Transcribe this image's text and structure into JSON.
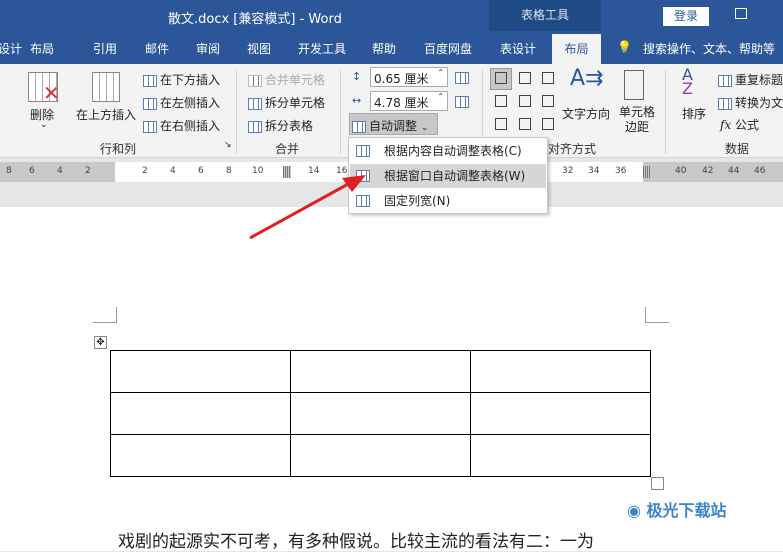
{
  "title_bar": {
    "doc_title": "散文.docx [兼容模式]  -  Word",
    "context_tab": "表格工具",
    "login": "登录"
  },
  "tabs": [
    {
      "label": "设计"
    },
    {
      "label": "布局"
    },
    {
      "label": "引用"
    },
    {
      "label": "邮件"
    },
    {
      "label": "审阅"
    },
    {
      "label": "视图"
    },
    {
      "label": "开发工具"
    },
    {
      "label": "帮助"
    },
    {
      "label": "百度网盘"
    },
    {
      "label": "表设计"
    },
    {
      "label": "布局",
      "active": true
    }
  ],
  "search": "搜索操作、文本、帮助等",
  "ribbon": {
    "rows_cols": {
      "delete": "删除",
      "insert_above": "在上方插入",
      "insert_below": "在下方插入",
      "insert_left": "在左侧插入",
      "insert_right": "在右侧插入",
      "group": "行和列"
    },
    "merge": {
      "merge_cells": "合并单元格",
      "split_cells": "拆分单元格",
      "split_table": "拆分表格",
      "group": "合并"
    },
    "size": {
      "height": "0.65 厘米",
      "width": "4.78 厘米",
      "autofit": "自动调整"
    },
    "align": {
      "text_direction": "文字方向",
      "cell_margins": "单元格边距",
      "group": "对齐方式"
    },
    "data": {
      "sort": "排序",
      "repeat_header": "重复标题",
      "convert": "转换为文",
      "formula": "公式",
      "group": "数据"
    }
  },
  "menu": [
    {
      "label": "根据内容自动调整表格(C)"
    },
    {
      "label": "根据窗口自动调整表格(W)",
      "highlighted": true
    },
    {
      "label": "固定列宽(N)"
    }
  ],
  "ruler": [
    "8",
    "6",
    "4",
    "2",
    "2",
    "4",
    "6",
    "8",
    "10",
    "14",
    "16",
    "32",
    "34",
    "36",
    "40",
    "42",
    "44",
    "46"
  ],
  "body_text": "戏剧的起源实不可考，有多种假说。比较主流的看法有二：一为",
  "watermark": "极光下载站",
  "colors": {
    "accent": "#2b579a",
    "arrow": "#e02020"
  }
}
